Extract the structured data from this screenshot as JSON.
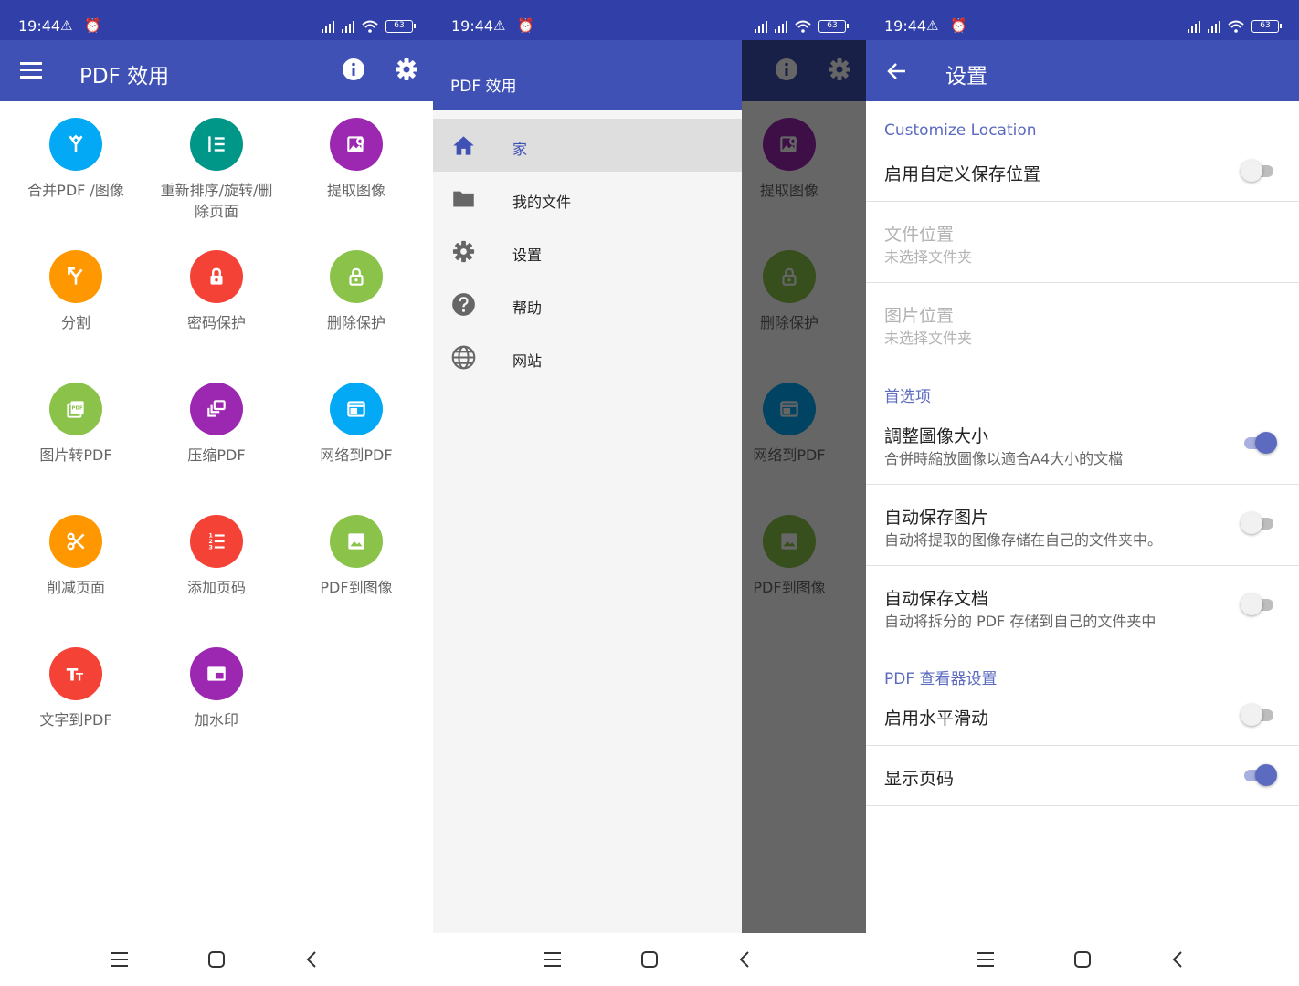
{
  "status": {
    "time": "19:44",
    "left_icons": "⚠ ⏰",
    "battery": "63"
  },
  "home": {
    "title": "PDF 效用",
    "tiles": [
      {
        "label": "合并PDF /图像",
        "color": "#03a9f4",
        "icon": "merge-icon"
      },
      {
        "label": "重新排序/旋转/删除页面",
        "color": "#009688",
        "icon": "reorder-list-icon"
      },
      {
        "label": "提取图像",
        "color": "#9c27b0",
        "icon": "extract-image-icon"
      },
      {
        "label": "分割",
        "color": "#ff9800",
        "icon": "split-icon"
      },
      {
        "label": "密码保护",
        "color": "#f44336",
        "icon": "lock-icon"
      },
      {
        "label": "删除保护",
        "color": "#8bc34a",
        "icon": "unlock-icon"
      },
      {
        "label": "图片转PDF",
        "color": "#8bc34a",
        "icon": "image-pdf-icon"
      },
      {
        "label": "压缩PDF",
        "color": "#9c27b0",
        "icon": "compress-icon"
      },
      {
        "label": "网络到PDF",
        "color": "#03a9f4",
        "icon": "web-page-icon"
      },
      {
        "label": "削减页面",
        "color": "#ff9800",
        "icon": "scissors-icon"
      },
      {
        "label": "添加页码",
        "color": "#f44336",
        "icon": "numbered-list-icon"
      },
      {
        "label": "PDF到图像",
        "color": "#8bc34a",
        "icon": "image-icon"
      },
      {
        "label": "文字到PDF",
        "color": "#f44336",
        "icon": "text-icon"
      },
      {
        "label": "加水印",
        "color": "#9c27b0",
        "icon": "watermark-icon"
      }
    ]
  },
  "drawer": {
    "title": "PDF 效用",
    "items": [
      {
        "label": "家",
        "icon": "home-icon"
      },
      {
        "label": "我的文件",
        "icon": "folder-icon"
      },
      {
        "label": "设置",
        "icon": "gear-icon"
      },
      {
        "label": "帮助",
        "icon": "help-icon"
      },
      {
        "label": "网站",
        "icon": "globe-icon"
      }
    ],
    "bg_tiles": [
      "提取图像",
      "删除保护",
      "网络到PDF",
      "PDF到图像"
    ]
  },
  "settings": {
    "title": "设置",
    "sections": {
      "location": "Customize Location",
      "prefs": "首选项",
      "viewer": "PDF 查看器设置"
    },
    "custom_location": {
      "title": "启用自定义保存位置",
      "enabled": false
    },
    "file_location": {
      "title": "文件位置",
      "subtitle": "未选择文件夹"
    },
    "image_location": {
      "title": "图片位置",
      "subtitle": "未选择文件夹"
    },
    "resize": {
      "title": "調整圖像大小",
      "subtitle": "合併時縮放圖像以適合A4大小的文檔",
      "enabled": true
    },
    "autosave_images": {
      "title": "自动保存图片",
      "subtitle": "自动将提取的图像存储在自己的文件夹中。",
      "enabled": false
    },
    "autosave_docs": {
      "title": "自动保存文档",
      "subtitle": "自动将拆分的 PDF 存储到自己的文件夹中",
      "enabled": false
    },
    "horizontal_scroll": {
      "title": "启用水平滑动",
      "enabled": false
    },
    "show_page_number": {
      "title": "显示页码",
      "enabled": true
    }
  },
  "colors": {
    "primary": "#3f51b5",
    "status": "#3040a8",
    "accent": "#5c6bc0"
  }
}
